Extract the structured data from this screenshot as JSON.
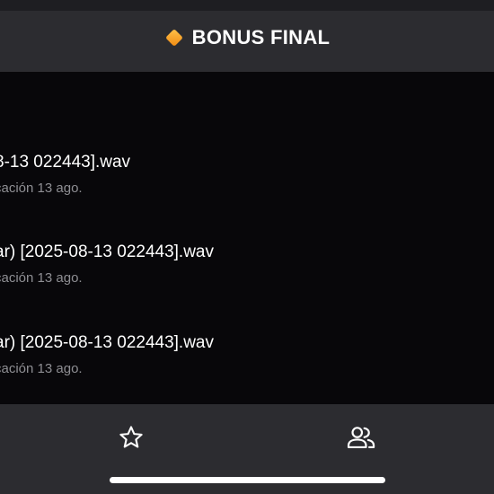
{
  "header": {
    "icon": "orange-diamond-icon",
    "title": "BONUS FINAL"
  },
  "list": {
    "items": [
      {
        "title": "8-13 022443].wav",
        "subtitle": "cación 13 ago."
      },
      {
        "title": "ar) [2025-08-13 022443].wav",
        "subtitle": "cación 13 ago."
      },
      {
        "title": "ar) [2025-08-13 022443].wav",
        "subtitle": "cación 13 ago."
      }
    ]
  },
  "tabbar": {
    "tabs": [
      {
        "icon": "star-icon"
      },
      {
        "icon": "people-icon"
      }
    ]
  },
  "colors": {
    "header_bg": "#2c2c30",
    "list_bg": "#08070a",
    "subtitle_text": "#8e8e93",
    "diamond_orange": "#f5a623"
  }
}
